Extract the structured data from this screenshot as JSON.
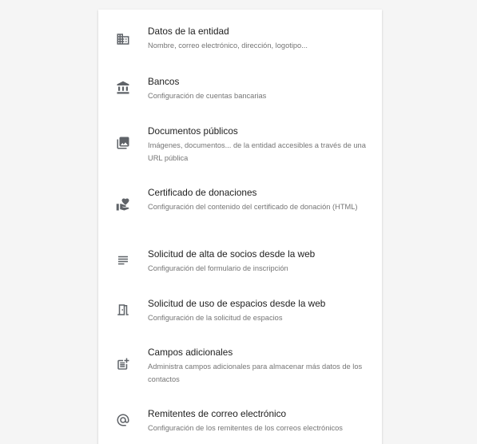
{
  "settings_menu": {
    "items": [
      {
        "icon": "domain-icon",
        "title": "Datos de la entidad",
        "subtitle": "Nombre, correo electrónico, dirección, logotipo..."
      },
      {
        "icon": "bank-icon",
        "title": "Bancos",
        "subtitle": "Configuración de cuentas bancarias"
      },
      {
        "icon": "photo-library-icon",
        "title": "Documentos públicos",
        "subtitle": "Imágenes, documentos... de la entidad accesibles a través de una URL pública"
      },
      {
        "icon": "volunteer-activism-icon",
        "title": "Certificado de donaciones",
        "subtitle": "Configuración del contenido del certificado de donación (HTML)"
      },
      {
        "icon": "form-lines-icon",
        "title": "Solicitud de alta de socios desde la web",
        "subtitle": "Configuración del formulario de inscripción"
      },
      {
        "icon": "door-icon",
        "title": "Solicitud de uso de espacios desde la web",
        "subtitle": "Configuración de la solicitud de espacios"
      },
      {
        "icon": "post-add-icon",
        "title": "Campos adicionales",
        "subtitle": "Administra campos adicionales para almacenar más datos de los contactos"
      },
      {
        "icon": "at-sign-icon",
        "title": "Remitentes de correo electrónico",
        "subtitle": "Configuración de los remitentes de los correos electrónicos"
      }
    ]
  }
}
